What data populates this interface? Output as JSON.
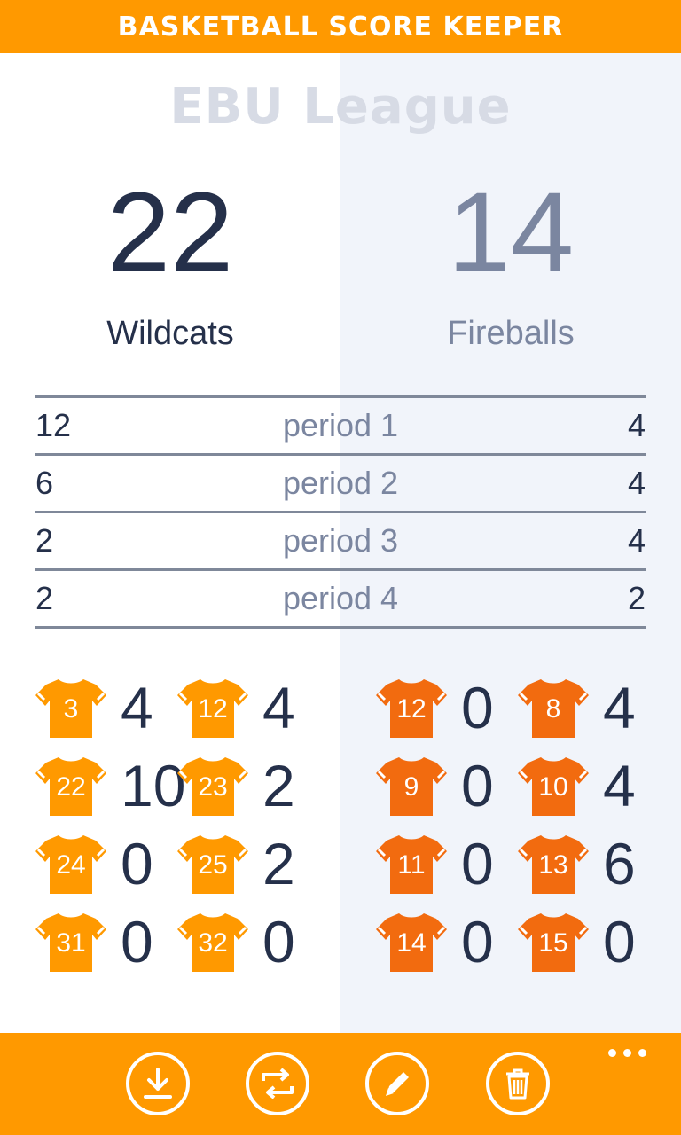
{
  "app": {
    "title": "BASKETBALL SCORE KEEPER"
  },
  "league": "EBU League",
  "home": {
    "name": "Wildcats",
    "score": "22"
  },
  "away": {
    "name": "Fireballs",
    "score": "14"
  },
  "periods": [
    {
      "label": "period 1",
      "home": "12",
      "away": "4"
    },
    {
      "label": "period 2",
      "home": "6",
      "away": "4"
    },
    {
      "label": "period 3",
      "home": "2",
      "away": "4"
    },
    {
      "label": "period 4",
      "home": "2",
      "away": "2"
    }
  ],
  "home_players": [
    {
      "number": "3",
      "points": "4"
    },
    {
      "number": "12",
      "points": "4"
    },
    {
      "number": "22",
      "points": "10"
    },
    {
      "number": "23",
      "points": "2"
    },
    {
      "number": "24",
      "points": "0"
    },
    {
      "number": "25",
      "points": "2"
    },
    {
      "number": "31",
      "points": "0"
    },
    {
      "number": "32",
      "points": "0"
    }
  ],
  "away_players": [
    {
      "number": "12",
      "points": "0"
    },
    {
      "number": "8",
      "points": "4"
    },
    {
      "number": "9",
      "points": "0"
    },
    {
      "number": "10",
      "points": "4"
    },
    {
      "number": "11",
      "points": "0"
    },
    {
      "number": "13",
      "points": "6"
    },
    {
      "number": "14",
      "points": "0"
    },
    {
      "number": "15",
      "points": "0"
    }
  ],
  "colors": {
    "accent": "#ff9900",
    "home_jersey": "#ff9900",
    "away_jersey": "#f26b0f",
    "text_dark": "#25304a",
    "text_muted": "#7b86a0"
  },
  "appbar": {
    "icons": [
      "download-icon",
      "swap-icon",
      "edit-icon",
      "delete-icon"
    ],
    "more": "more-icon"
  }
}
